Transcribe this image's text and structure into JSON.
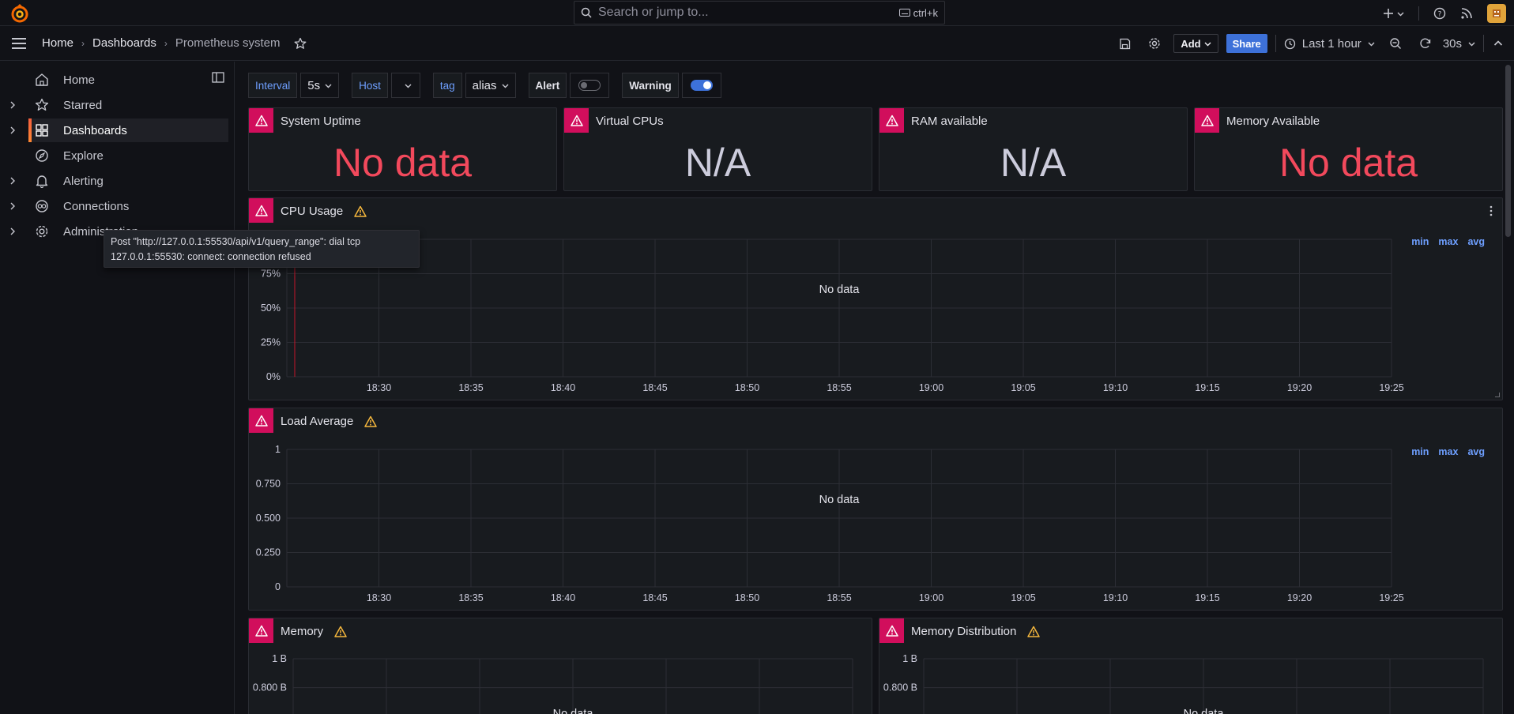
{
  "topbar": {
    "search_placeholder": "Search or jump to...",
    "search_shortcut": "ctrl+k"
  },
  "breadcrumb": [
    "Home",
    "Dashboards",
    "Prometheus system"
  ],
  "toolbar": {
    "add_label": "Add",
    "share_label": "Share",
    "time_range": "Last 1 hour",
    "refresh_interval": "30s"
  },
  "sidebar": {
    "items": [
      {
        "label": "Home",
        "icon": "home-icon",
        "expandable": false
      },
      {
        "label": "Starred",
        "icon": "star-icon",
        "expandable": true
      },
      {
        "label": "Dashboards",
        "icon": "apps-icon",
        "expandable": true,
        "active": true
      },
      {
        "label": "Explore",
        "icon": "compass-icon",
        "expandable": false
      },
      {
        "label": "Alerting",
        "icon": "bell-icon",
        "expandable": true
      },
      {
        "label": "Connections",
        "icon": "connections-icon",
        "expandable": true
      },
      {
        "label": "Administration",
        "icon": "cog-icon",
        "expandable": true
      }
    ]
  },
  "tooltip": {
    "line1": "Post \"http://127.0.0.1:55530/api/v1/query_range\": dial tcp",
    "line2": "127.0.0.1:55530: connect: connection refused"
  },
  "variables": {
    "interval_label": "Interval",
    "interval_value": "5s",
    "host_label": "Host",
    "host_value": "",
    "tag_label": "tag",
    "tag_value": "alias",
    "alert_label": "Alert",
    "alert_on": false,
    "warning_label": "Warning",
    "warning_on": true
  },
  "stats": [
    {
      "title": "System Uptime",
      "value": "No data",
      "color": "#f2495c"
    },
    {
      "title": "Virtual CPUs",
      "value": "N/A",
      "color": "#ccccdc"
    },
    {
      "title": "RAM available",
      "value": "N/A",
      "color": "#ccccdc"
    },
    {
      "title": "Memory Available",
      "value": "No data",
      "color": "#f2495c"
    }
  ],
  "legend_links": [
    "min",
    "max",
    "avg"
  ],
  "no_data_text": "No data",
  "colors": {
    "error": "#d10e5c",
    "warning": "#f5b73d",
    "accent": "#3d71d9",
    "link": "#6e9fff"
  },
  "chart_data": [
    {
      "type": "line",
      "title": "CPU Usage",
      "x": [
        "18:30",
        "18:35",
        "18:40",
        "18:45",
        "18:50",
        "18:55",
        "19:00",
        "19:05",
        "19:10",
        "19:15",
        "19:20",
        "19:25"
      ],
      "y_ticks": [
        "75%",
        "50%",
        "25%",
        "0%"
      ],
      "series": [],
      "grid": true,
      "note": "No data"
    },
    {
      "type": "line",
      "title": "Load Average",
      "x": [
        "18:30",
        "18:35",
        "18:40",
        "18:45",
        "18:50",
        "18:55",
        "19:00",
        "19:05",
        "19:10",
        "19:15",
        "19:20",
        "19:25"
      ],
      "y_ticks": [
        "1",
        "0.750",
        "0.500",
        "0.250",
        "0"
      ],
      "series": [],
      "grid": true,
      "note": "No data"
    },
    {
      "type": "line",
      "title": "Memory",
      "y_ticks": [
        "1 B",
        "0.800 B"
      ],
      "series": [],
      "grid": true,
      "note": "No data"
    },
    {
      "type": "line",
      "title": "Memory Distribution",
      "y_ticks": [
        "1 B",
        "0.800 B"
      ],
      "series": [],
      "grid": true,
      "note": "No data"
    }
  ]
}
